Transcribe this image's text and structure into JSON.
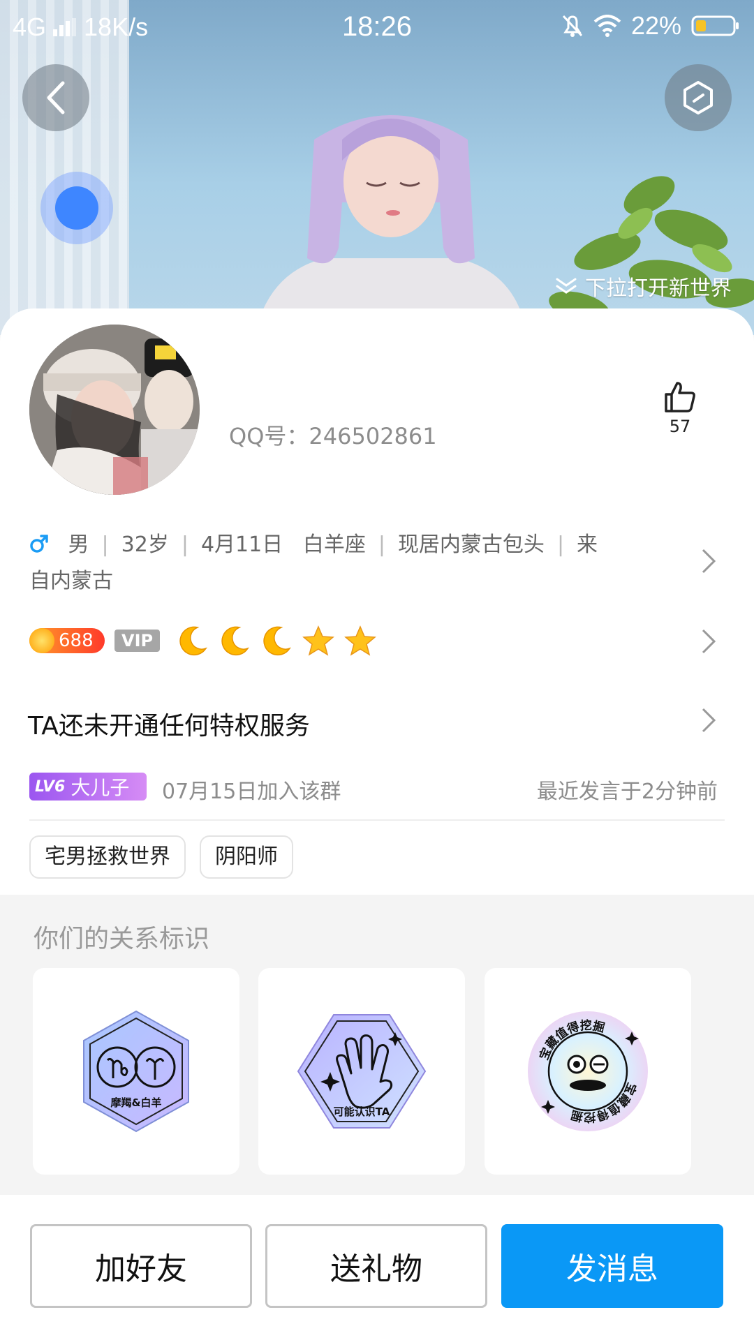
{
  "status_bar": {
    "network": "4G",
    "speed": "18K/s",
    "time": "18:26",
    "battery": "22%"
  },
  "hero": {
    "pull_hint": "下拉打开新世界",
    "icons": [
      "back-arrow-icon",
      "hexagon-menu-icon",
      "blue-dot-icon"
    ]
  },
  "profile": {
    "qq_label": "QQ号：",
    "qq_number": "246502861",
    "likes": "57",
    "info_line1": [
      "男",
      "32岁",
      "4月11日",
      "白羊座",
      "现居内蒙古包头",
      "来"
    ],
    "info_line2": "自内蒙古",
    "coin_level": "688",
    "vip_label": "VIP",
    "level_icons": [
      "moon",
      "moon",
      "moon",
      "star",
      "star"
    ],
    "privilege_text": "TA还未开通任何特权服务",
    "group_level": "LV6",
    "group_title": "大儿子",
    "joined_text": "07月15日加入该群",
    "last_spoke": "最近发言于2分钟前",
    "tags": [
      "宅男拯救世界",
      "阴阳师"
    ]
  },
  "relationship": {
    "title": "你们的关系标识",
    "badges": [
      {
        "label": "摩羯&白羊"
      },
      {
        "label": "可能认识TA"
      },
      {
        "label": "宝藏值得挖掘"
      }
    ]
  },
  "footer": {
    "add_friend": "加好友",
    "send_gift": "送礼物",
    "send_message": "发消息"
  },
  "colors": {
    "primary": "#0a98f6",
    "level_purple": "#9b56f0",
    "coin_red": "#ff3a2a"
  }
}
